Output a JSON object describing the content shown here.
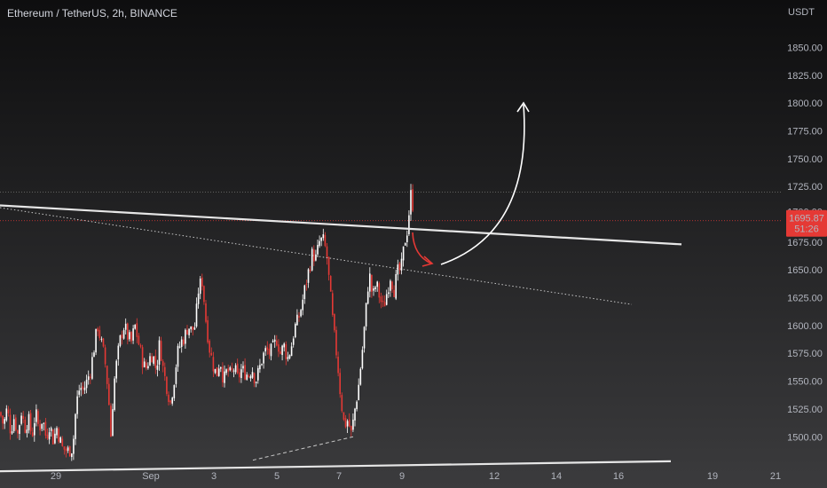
{
  "header": {
    "symbol_line": "Ethereum / TetherUS, 2h, BINANCE",
    "currency": "USDT"
  },
  "price_tag": {
    "price": "1695.87",
    "countdown": "51:26"
  },
  "colors": {
    "background": "#131722",
    "up": "#ffffff",
    "down": "#e53935",
    "trendline": "#e6e6e6",
    "arrow_up": "#ffffff",
    "arrow_down": "#e53935",
    "price_line": "#e53935",
    "dotted_high": "#bbbbbb"
  },
  "chart_data": {
    "type": "candlestick",
    "title": "Ethereum / TetherUS, 2h, BINANCE",
    "ylabel": "USDT",
    "ylim": [
      1487,
      1860
    ],
    "y_ticks": [
      1500,
      1525,
      1550,
      1575,
      1600,
      1625,
      1650,
      1675,
      1700,
      1725,
      1750,
      1775,
      1800,
      1825,
      1850
    ],
    "x_ticks": [
      "29",
      "Sep",
      "3",
      "5",
      "7",
      "9",
      "12",
      "14",
      "16",
      "19",
      "21"
    ],
    "last_price": 1695.87,
    "marked_high": 1720,
    "price_path": [
      [
        0,
        1522
      ],
      [
        4,
        1510
      ],
      [
        8,
        1526
      ],
      [
        12,
        1505
      ],
      [
        16,
        1518
      ],
      [
        20,
        1502
      ],
      [
        24,
        1523
      ],
      [
        28,
        1508
      ],
      [
        32,
        1516
      ],
      [
        36,
        1500
      ],
      [
        40,
        1522
      ],
      [
        44,
        1507
      ],
      [
        48,
        1517
      ],
      [
        52,
        1499
      ],
      [
        56,
        1512
      ],
      [
        60,
        1497
      ],
      [
        64,
        1508
      ],
      [
        70,
        1490
      ],
      [
        76,
        1487
      ],
      [
        82,
        1490
      ],
      [
        86,
        1530
      ],
      [
        90,
        1545
      ],
      [
        94,
        1542
      ],
      [
        98,
        1550
      ],
      [
        102,
        1560
      ],
      [
        106,
        1580
      ],
      [
        110,
        1600
      ],
      [
        114,
        1585
      ],
      [
        118,
        1570
      ],
      [
        122,
        1540
      ],
      [
        125,
        1500
      ],
      [
        128,
        1545
      ],
      [
        132,
        1570
      ],
      [
        136,
        1590
      ],
      [
        140,
        1600
      ],
      [
        144,
        1590
      ],
      [
        148,
        1585
      ],
      [
        152,
        1600
      ],
      [
        156,
        1585
      ],
      [
        160,
        1570
      ],
      [
        164,
        1560
      ],
      [
        168,
        1570
      ],
      [
        172,
        1575
      ],
      [
        176,
        1560
      ],
      [
        180,
        1585
      ],
      [
        184,
        1560
      ],
      [
        188,
        1545
      ],
      [
        192,
        1530
      ],
      [
        196,
        1550
      ],
      [
        200,
        1575
      ],
      [
        204,
        1585
      ],
      [
        208,
        1590
      ],
      [
        212,
        1600
      ],
      [
        216,
        1595
      ],
      [
        220,
        1600
      ],
      [
        224,
        1635
      ],
      [
        228,
        1640
      ],
      [
        232,
        1605
      ],
      [
        236,
        1580
      ],
      [
        240,
        1565
      ],
      [
        244,
        1555
      ],
      [
        248,
        1570
      ],
      [
        252,
        1550
      ],
      [
        256,
        1560
      ],
      [
        260,
        1555
      ],
      [
        264,
        1562
      ],
      [
        268,
        1552
      ],
      [
        272,
        1560
      ],
      [
        276,
        1558
      ],
      [
        280,
        1555
      ],
      [
        284,
        1562
      ],
      [
        288,
        1550
      ],
      [
        292,
        1560
      ],
      [
        296,
        1572
      ],
      [
        300,
        1578
      ],
      [
        304,
        1575
      ],
      [
        308,
        1580
      ],
      [
        312,
        1588
      ],
      [
        316,
        1575
      ],
      [
        320,
        1582
      ],
      [
        324,
        1570
      ],
      [
        328,
        1580
      ],
      [
        332,
        1598
      ],
      [
        336,
        1605
      ],
      [
        340,
        1618
      ],
      [
        344,
        1635
      ],
      [
        348,
        1650
      ],
      [
        352,
        1665
      ],
      [
        356,
        1660
      ],
      [
        360,
        1675
      ],
      [
        364,
        1677
      ],
      [
        368,
        1665
      ],
      [
        372,
        1630
      ],
      [
        376,
        1595
      ],
      [
        380,
        1570
      ],
      [
        384,
        1535
      ],
      [
        388,
        1510
      ],
      [
        392,
        1515
      ],
      [
        396,
        1502
      ],
      [
        400,
        1525
      ],
      [
        404,
        1545
      ],
      [
        408,
        1575
      ],
      [
        412,
        1610
      ],
      [
        416,
        1648
      ],
      [
        420,
        1625
      ],
      [
        424,
        1638
      ],
      [
        428,
        1625
      ],
      [
        432,
        1615
      ],
      [
        436,
        1630
      ],
      [
        440,
        1645
      ],
      [
        444,
        1632
      ],
      [
        448,
        1648
      ],
      [
        452,
        1650
      ],
      [
        456,
        1675
      ],
      [
        460,
        1690
      ],
      [
        462,
        1715
      ],
      [
        464,
        1720
      ],
      [
        466,
        1700
      ],
      [
        468,
        1695
      ]
    ],
    "trendlines": [
      {
        "from": [
          "x0",
          "1708"
        ],
        "to": [
          "x768",
          "1673"
        ],
        "style": "solid"
      },
      {
        "from": [
          "x0",
          "1469"
        ],
        "to": [
          "x756",
          "1478"
        ],
        "style": "solid"
      },
      {
        "from": [
          "x0",
          "1706"
        ],
        "to": [
          "x712",
          "1619"
        ],
        "style": "dotted"
      },
      {
        "from": [
          "x285",
          "1479"
        ],
        "to": [
          "x398",
          "1500"
        ],
        "style": "dashed"
      }
    ],
    "annotations": [
      {
        "type": "arrow",
        "color": "red",
        "direction": "down",
        "label": ""
      },
      {
        "type": "arrow",
        "color": "white",
        "direction": "up",
        "label": ""
      }
    ]
  }
}
